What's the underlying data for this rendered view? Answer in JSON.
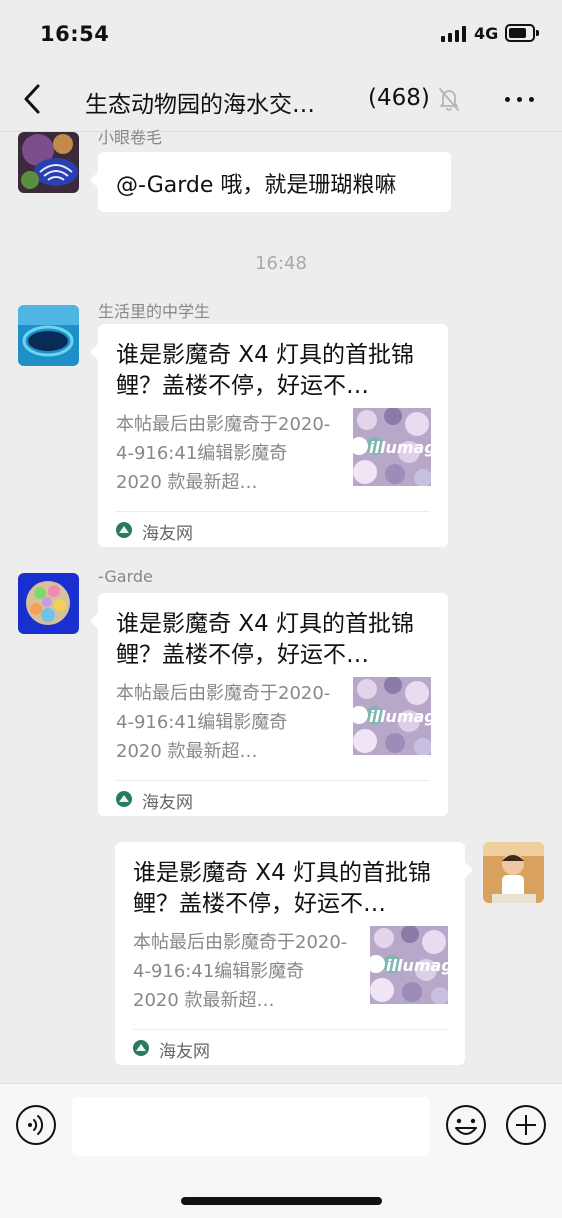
{
  "status_bar": {
    "time": "16:54",
    "network": "4G"
  },
  "header": {
    "title": "生态动物园的海水交…",
    "member_count": "(468)"
  },
  "messages": [
    {
      "sender": "小眼卷毛",
      "text": "@-Garde 哦，就是珊瑚粮嘛"
    },
    {
      "timestamp": "16:48"
    },
    {
      "sender": "生活里的中学生",
      "link_title": "谁是影魔奇 X4 灯具的首批锦鲤？盖楼不停，好运不…",
      "link_desc": "本帖最后由影魔奇于2020-4-916:41编辑影魔奇 2020 款最新超…",
      "thumb_text": "illumag",
      "source": "海友网"
    },
    {
      "sender": "-Garde",
      "link_title": "谁是影魔奇 X4 灯具的首批锦鲤？盖楼不停，好运不…",
      "link_desc": "本帖最后由影魔奇于2020-4-916:41编辑影魔奇 2020 款最新超…",
      "thumb_text": "illumag",
      "source": "海友网"
    },
    {
      "link_title": "谁是影魔奇 X4 灯具的首批锦鲤？盖楼不停，好运不…",
      "link_desc": "本帖最后由影魔奇于2020-4-916:41编辑影魔奇 2020 款最新超…",
      "thumb_text": "illumag",
      "source": "海友网"
    }
  ],
  "input": {
    "value": ""
  },
  "icons": {
    "back": "chevron-left-icon",
    "mute": "bell-slash-icon",
    "more": "more-dots-icon",
    "voice": "voice-icon",
    "emoji": "emoji-icon",
    "plus": "plus-circle-icon",
    "source": "haiyou-logo-icon"
  },
  "colors": {
    "background": "#ededed",
    "bubble": "#ffffff",
    "link_source_icon": "#2a7a5e"
  }
}
